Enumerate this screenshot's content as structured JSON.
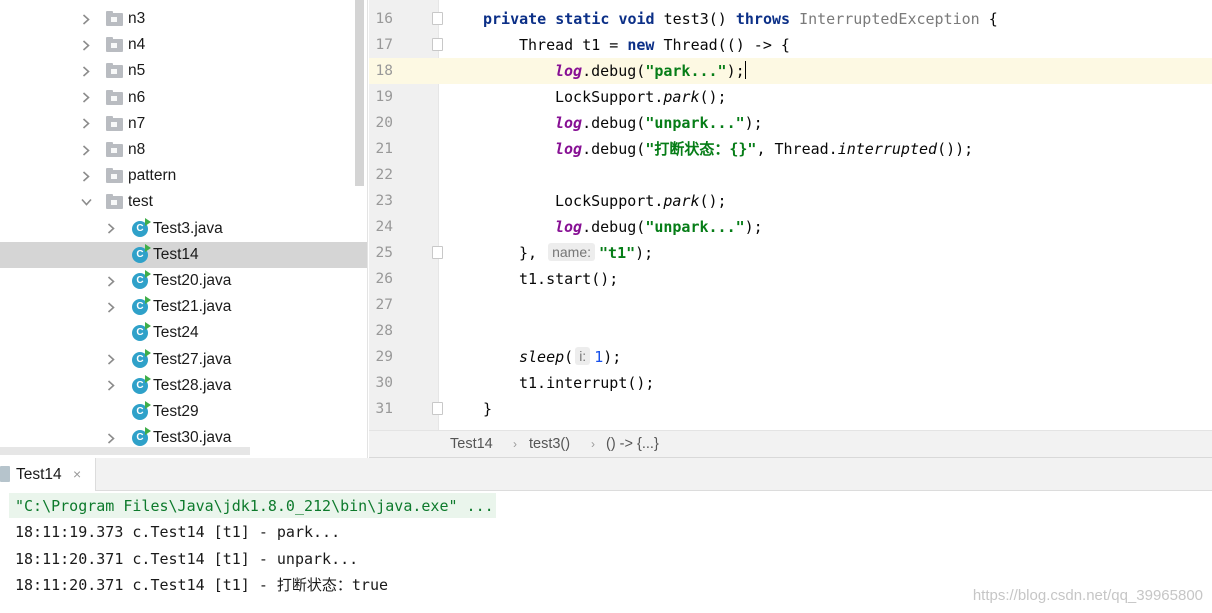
{
  "tree": {
    "items": [
      {
        "label": "n3",
        "kind": "folder",
        "icon": "folder-icon",
        "expanded": false
      },
      {
        "label": "n4",
        "kind": "folder",
        "icon": "folder-icon",
        "expanded": false
      },
      {
        "label": "n5",
        "kind": "folder",
        "icon": "folder-icon",
        "expanded": false
      },
      {
        "label": "n6",
        "kind": "folder",
        "icon": "folder-icon",
        "expanded": false
      },
      {
        "label": "n7",
        "kind": "folder",
        "icon": "folder-icon",
        "expanded": false
      },
      {
        "label": "n8",
        "kind": "folder",
        "icon": "folder-icon",
        "expanded": false
      },
      {
        "label": "pattern",
        "kind": "folder",
        "icon": "folder-icon",
        "expanded": false
      },
      {
        "label": "test",
        "kind": "folder",
        "icon": "folder-icon",
        "expanded": true
      },
      {
        "label": "Test3.java",
        "kind": "class",
        "icon": "java-class-icon",
        "expandable": true
      },
      {
        "label": "Test14",
        "kind": "class",
        "icon": "java-class-icon",
        "expandable": false,
        "selected": true
      },
      {
        "label": "Test20.java",
        "kind": "class",
        "icon": "java-class-icon",
        "expandable": true
      },
      {
        "label": "Test21.java",
        "kind": "class",
        "icon": "java-class-icon",
        "expandable": true
      },
      {
        "label": "Test24",
        "kind": "class",
        "icon": "java-class-icon",
        "expandable": false
      },
      {
        "label": "Test27.java",
        "kind": "class",
        "icon": "java-class-icon",
        "expandable": true
      },
      {
        "label": "Test28.java",
        "kind": "class",
        "icon": "java-class-icon",
        "expandable": true
      },
      {
        "label": "Test29",
        "kind": "class",
        "icon": "java-class-icon",
        "expandable": false
      },
      {
        "label": "Test30.java",
        "kind": "class",
        "icon": "java-class-icon",
        "expandable": true
      }
    ],
    "class_icon_letter": "C"
  },
  "editor": {
    "current_line": 18,
    "lines": [
      {
        "n": "16",
        "fold": true
      },
      {
        "n": "17",
        "fold": true
      },
      {
        "n": "18"
      },
      {
        "n": "19"
      },
      {
        "n": "20"
      },
      {
        "n": "21"
      },
      {
        "n": "22"
      },
      {
        "n": "23"
      },
      {
        "n": "24"
      },
      {
        "n": "25",
        "fold": true
      },
      {
        "n": "26"
      },
      {
        "n": "27"
      },
      {
        "n": "28"
      },
      {
        "n": "29"
      },
      {
        "n": "30"
      },
      {
        "n": "31",
        "fold": true
      }
    ],
    "code": {
      "l16": {
        "kw": "private static void",
        "name": " test3() ",
        "throws": "throws",
        "exc": " InterruptedException",
        "brace": " {"
      },
      "l17": {
        "pre": "Thread t1 = ",
        "kw": "new",
        "post": " Thread(() -> {"
      },
      "l18": {
        "obj": "log",
        "call": ".debug(",
        "str": "\"park...\"",
        "end": ");"
      },
      "l19": {
        "pre": "LockSupport.",
        "method": "park",
        "end": "();"
      },
      "l20": {
        "obj": "log",
        "call": ".debug(",
        "str": "\"unpark...\"",
        "end": ");"
      },
      "l21": {
        "obj": "log",
        "call": ".debug(",
        "str": "\"打断状态：{}\"",
        "mid": ", Thread.",
        "method": "interrupted",
        "end": "());"
      },
      "l23": {
        "pre": "LockSupport.",
        "method": "park",
        "end": "();"
      },
      "l24": {
        "obj": "log",
        "call": ".debug(",
        "str": "\"unpark...\"",
        "end": ");"
      },
      "l25": {
        "pre": "}, ",
        "hint": "name:",
        "str": "\"t1\"",
        "end": ");"
      },
      "l26": {
        "text": "t1.start();"
      },
      "l29": {
        "method": "sleep",
        "open": "(",
        "hint": "i:",
        "num": "1",
        "end": ");"
      },
      "l30": {
        "text": "t1.interrupt();"
      },
      "l31": {
        "text": "}"
      }
    }
  },
  "breadcrumb": {
    "items": [
      "Test14",
      "test3()",
      "() -> {...}"
    ],
    "separator": "›"
  },
  "run_panel": {
    "tab_label": "Test14",
    "close_glyph": "×",
    "console": [
      "\"C:\\Program Files\\Java\\jdk1.8.0_212\\bin\\java.exe\" ...",
      "18:11:19.373 c.Test14 [t1] - park...",
      "18:11:20.371 c.Test14 [t1] - unpark...",
      "18:11:20.371 c.Test14 [t1] - 打断状态：true"
    ]
  },
  "watermark": "https://blog.csdn.net/qq_39965800",
  "colors": {
    "keyword": "#0b2f87",
    "string": "#067d17",
    "field": "#871094",
    "number": "#1750eb",
    "current_line": "#fdf9e3",
    "selection": "#d5d5d5",
    "console_cmd": "#0d7a2c"
  }
}
